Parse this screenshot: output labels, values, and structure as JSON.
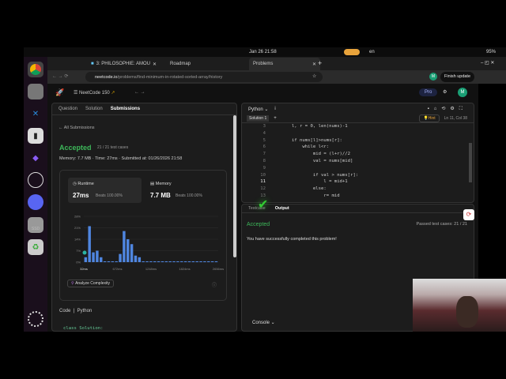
{
  "system": {
    "datetime": "Jan 26  21:58",
    "lang": "en",
    "battery": "95%"
  },
  "dock": [
    {
      "name": "chrome"
    },
    {
      "name": "files"
    },
    {
      "name": "vscode"
    },
    {
      "name": "terminal"
    },
    {
      "name": "obsidian"
    },
    {
      "name": "obs"
    },
    {
      "name": "discord"
    },
    {
      "name": "ssd",
      "label": "SSD"
    },
    {
      "name": "trash"
    }
  ],
  "browser": {
    "tabs": [
      {
        "label": "3: PHILOSOPHIE: AMOU"
      },
      {
        "label": "Roadmap"
      },
      {
        "label": "Problems",
        "active": true
      }
    ],
    "url_host": "neetcode.io",
    "url_path": "/problems/find-minimum-in-rotated-sorted-array/history",
    "finish_update": "Finish update",
    "profile": "M"
  },
  "neetcode": {
    "list": "NeetCode 150",
    "pro": "Pro",
    "avatar": "M"
  },
  "left": {
    "tabs": [
      "Question",
      "Solution",
      "Submissions"
    ],
    "back": "All Submissions",
    "status": "Accepted",
    "tests": "21 / 21 test cases",
    "meta": "Memory: 7.7 MB  ·  Time: 27ms  ·  Submitted at: 01/26/2026 21:58",
    "runtime_label": "Runtime",
    "runtime": "27ms",
    "runtime_beats": "Beats 100.00%",
    "memory_label": "Memory",
    "memory": "7.7 MB",
    "memory_beats": "Beats 100.00%",
    "analyze": "Analyze Complexity",
    "code_label": "Code",
    "lang": "Python",
    "code_peek": "class Solution:"
  },
  "chart_data": {
    "type": "bar",
    "title": "Runtime distribution",
    "ylabel": "%",
    "ylim": [
      0,
      28
    ],
    "yticks": [
      "28%",
      "21%",
      "14%",
      "7%",
      "0%"
    ],
    "xticks": [
      "32ms",
      "672ms",
      "1248ms",
      "1824ms",
      "2656ms"
    ],
    "values": [
      3,
      22,
      6,
      7,
      3,
      0.5,
      0.5,
      0.5,
      0.5,
      5,
      19,
      14,
      11,
      4,
      3,
      0.5,
      0.5,
      0.5,
      0.5,
      0.5,
      0.5,
      0.5,
      0.5,
      0.5,
      0.5,
      0.5,
      0.5,
      0.5,
      0.5,
      0.5,
      0.5,
      0.5,
      0.5,
      0.5,
      0.5
    ],
    "marker": "27ms"
  },
  "editor": {
    "lang": "Python",
    "tab": "Solution 1",
    "hint": "Hint",
    "pos": "Ln 11, Col 38",
    "lines": [
      {
        "n": "3",
        "t": "        l, r = 0, len(nums)-1"
      },
      {
        "n": "4",
        "t": ""
      },
      {
        "n": "5",
        "t": "        if nums[l]>nums[r]:"
      },
      {
        "n": "6",
        "t": "            while l<r:"
      },
      {
        "n": "7",
        "t": "                mid = (l+r)//2"
      },
      {
        "n": "8",
        "t": "                val = nums[mid]"
      },
      {
        "n": "9",
        "t": ""
      },
      {
        "n": "10",
        "t": "                if val > nums[r]:"
      },
      {
        "n": "11",
        "t": "                    l = mid+1"
      },
      {
        "n": "12",
        "t": "                else:"
      },
      {
        "n": "13",
        "t": "                    r= mid"
      }
    ]
  },
  "output": {
    "tabs": [
      "Testcase",
      "Output"
    ],
    "status": "Accepted",
    "passed": "Passed test cases: 21 / 21",
    "message": "You have successfully completed this problem!",
    "console": "Console"
  }
}
